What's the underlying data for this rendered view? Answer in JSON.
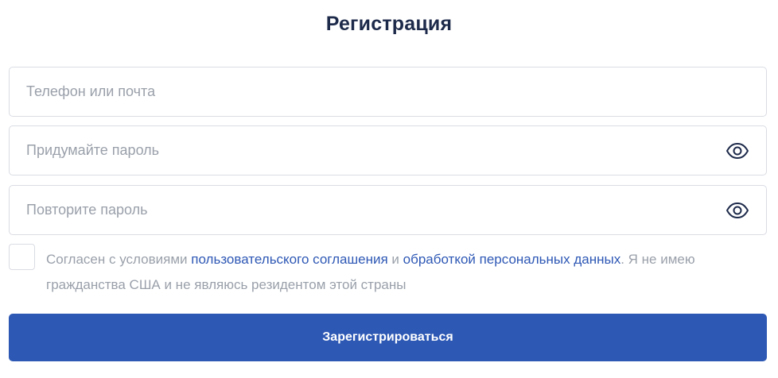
{
  "title": "Регистрация",
  "fields": {
    "login": {
      "value": "",
      "placeholder": "Телефон или почта"
    },
    "password": {
      "value": "",
      "placeholder": "Придумайте пароль"
    },
    "password_repeat": {
      "value": "",
      "placeholder": "Повторите пароль"
    }
  },
  "icons": {
    "password_toggle": "eye-icon",
    "password_repeat_toggle": "eye-icon"
  },
  "consent": {
    "checked": false,
    "text_before": "Согласен с условиями ",
    "link_user_agreement": "пользовательского соглашения",
    "text_and": " и ",
    "link_personal_data": "обработкой персональных данных",
    "text_after": ". Я не имею гражданства США и не являюсь резидентом этой страны"
  },
  "submit_label": "Зарегистрироваться",
  "colors": {
    "title": "#1d2a4a",
    "button": "#2d58b4",
    "link": "#2e58b5",
    "placeholder": "#9aa0aa",
    "border": "#d9dce3"
  }
}
